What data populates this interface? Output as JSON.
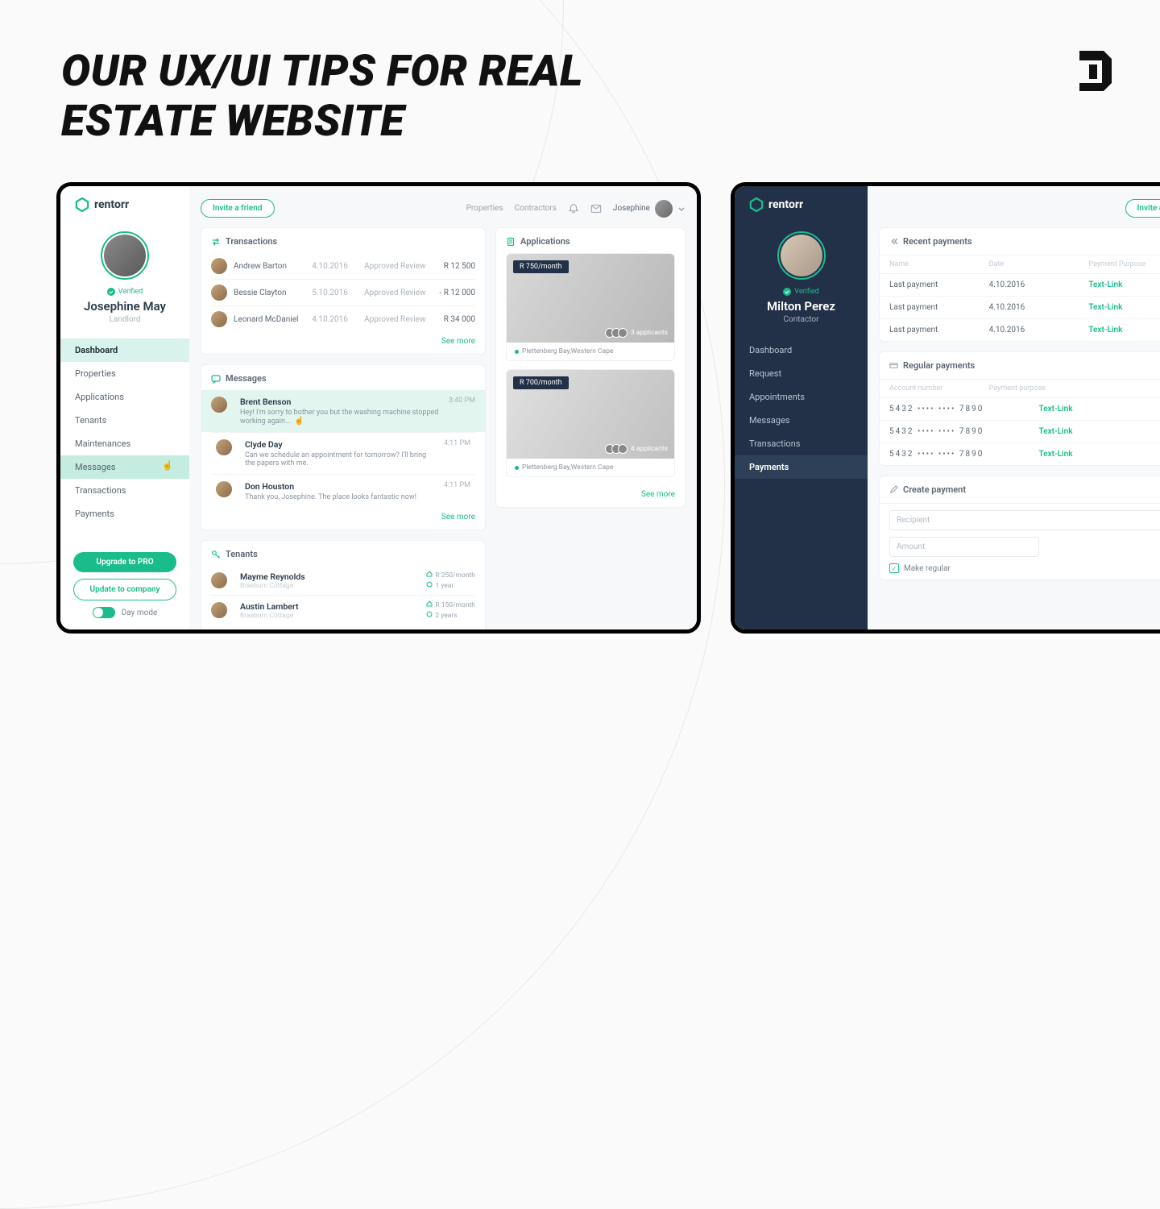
{
  "headline": "OUR UX/UI TIPS FOR REAL ESTATE WEBSITE",
  "brand": "rentorr",
  "invite_btn": "Invite a friend",
  "left": {
    "top_links": [
      "Properties",
      "Contractors"
    ],
    "user_chip": "Josephine",
    "profile": {
      "verified": "Verified",
      "name": "Josephine May",
      "role": "Landlord"
    },
    "nav": [
      "Dashboard",
      "Properties",
      "Applications",
      "Tenants",
      "Maintenances",
      "Messages",
      "Transactions",
      "Payments"
    ],
    "nav_active": 0,
    "nav_hover": 5,
    "actions": {
      "pro": "Upgrade to PRO",
      "company": "Update to company",
      "daymode": "Day mode"
    },
    "transactions": {
      "title": "Transactions",
      "rows": [
        {
          "name": "Andrew Barton",
          "date": "4.10.2016",
          "status": "Approved Review",
          "amount": "R 12 500"
        },
        {
          "name": "Bessie Clayton",
          "date": "5.10.2016",
          "status": "Approved Review",
          "amount": "- R 12 000"
        },
        {
          "name": "Leonard McDaniel",
          "date": "4.10.2016",
          "status": "Approved Review",
          "amount": "R 34 000"
        }
      ],
      "see_more": "See more"
    },
    "messages": {
      "title": "Messages",
      "rows": [
        {
          "name": "Brent Benson",
          "text": "Hey! I'm sorry to bother you but the washing machine stopped working again...",
          "time": "3:40 PM"
        },
        {
          "name": "Clyde Day",
          "text": "Can we schedule an appointment for tomorrow? I'll bring the papers with me.",
          "time": "4:11 PM"
        },
        {
          "name": "Don Houston",
          "text": "Thank you, Josephine. The place looks fantastic now!",
          "time": "4:11 PM"
        }
      ],
      "see_more": "See more"
    },
    "tenants": {
      "title": "Tenants",
      "rows": [
        {
          "name": "Mayme Reynolds",
          "sub": "Braeburn Cottage",
          "rate": "R 250/month",
          "dur": "1 year"
        },
        {
          "name": "Austin Lambert",
          "sub": "Braeburn Cottage",
          "rate": "R 150/month",
          "dur": "2 years"
        }
      ]
    },
    "applications": {
      "title": "Applications",
      "props": [
        {
          "price": "R 750/month",
          "applicants": "3 applicants",
          "loc": "Plettenberg Bay,Western Cape"
        },
        {
          "price": "R 700/month",
          "applicants": "4 applicants",
          "loc": "Plettenberg Bay,Western Cape"
        }
      ],
      "see_more": "See more"
    }
  },
  "right": {
    "profile": {
      "verified": "Verified",
      "name": "Milton Perez",
      "role": "Contactor"
    },
    "nav": [
      "Dashboard",
      "Request",
      "Appointments",
      "Messages",
      "Transactions",
      "Payments"
    ],
    "nav_active": 5,
    "recent": {
      "title": "Recent payments",
      "headers": [
        "Name",
        "Date",
        "Payment Purpose"
      ],
      "rows": [
        {
          "name": "Last payment",
          "date": "4.10.2016",
          "link": "Text-Link"
        },
        {
          "name": "Last payment",
          "date": "4.10.2016",
          "link": "Text-Link"
        },
        {
          "name": "Last payment",
          "date": "4.10.2016",
          "link": "Text-Link"
        }
      ]
    },
    "regular": {
      "title": "Regular payments",
      "headers": [
        "Account number",
        "Payment purpose",
        ""
      ],
      "rows": [
        {
          "acct": "5432  •••• ••••  7890",
          "link": "Text-Link"
        },
        {
          "acct": "5432  •••• ••••  7890",
          "link": "Text-Link"
        },
        {
          "acct": "5432  •••• ••••  7890",
          "link": "Text-Link"
        }
      ]
    },
    "create": {
      "title": "Create payment",
      "recipient": "Recipient",
      "amount": "Amount",
      "regular": "Make regular"
    }
  }
}
